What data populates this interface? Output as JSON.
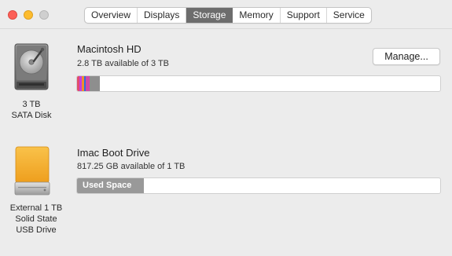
{
  "window": {
    "traffic_lights": [
      "close",
      "minimize",
      "zoom"
    ]
  },
  "tabs": [
    {
      "label": "Overview",
      "active": false
    },
    {
      "label": "Displays",
      "active": false
    },
    {
      "label": "Storage",
      "active": true
    },
    {
      "label": "Memory",
      "active": false
    },
    {
      "label": "Support",
      "active": false
    },
    {
      "label": "Service",
      "active": false
    }
  ],
  "disks": [
    {
      "icon": "internal-hard-disk-icon",
      "caption_lines": [
        "3 TB",
        "SATA Disk"
      ],
      "name": "Macintosh HD",
      "available": "2.8 TB available of 3 TB",
      "button_label": "Manage...",
      "usage_segments_fraction": [
        0.006,
        0.007,
        0.006,
        0.005,
        0.01,
        0.029
      ],
      "usage_colors": [
        "#e14d6d",
        "#c73de0",
        "#f08c2c",
        "#2d6fdc",
        "#d14aa3",
        "#8e8e8e"
      ]
    },
    {
      "icon": "external-usb-drive-icon",
      "caption_lines": [
        "External 1 TB",
        "Solid State",
        "USB Drive"
      ],
      "name": "Imac Boot Drive",
      "available": "817.25 GB available of 1 TB",
      "used_label": "Used Space",
      "used_fraction": 0.183
    }
  ],
  "colors": {
    "window_bg": "#ececec",
    "tab_active_bg": "#6d6d6d",
    "used_space_gray": "#999999",
    "usb_drive_orange": "#f7b12c"
  }
}
